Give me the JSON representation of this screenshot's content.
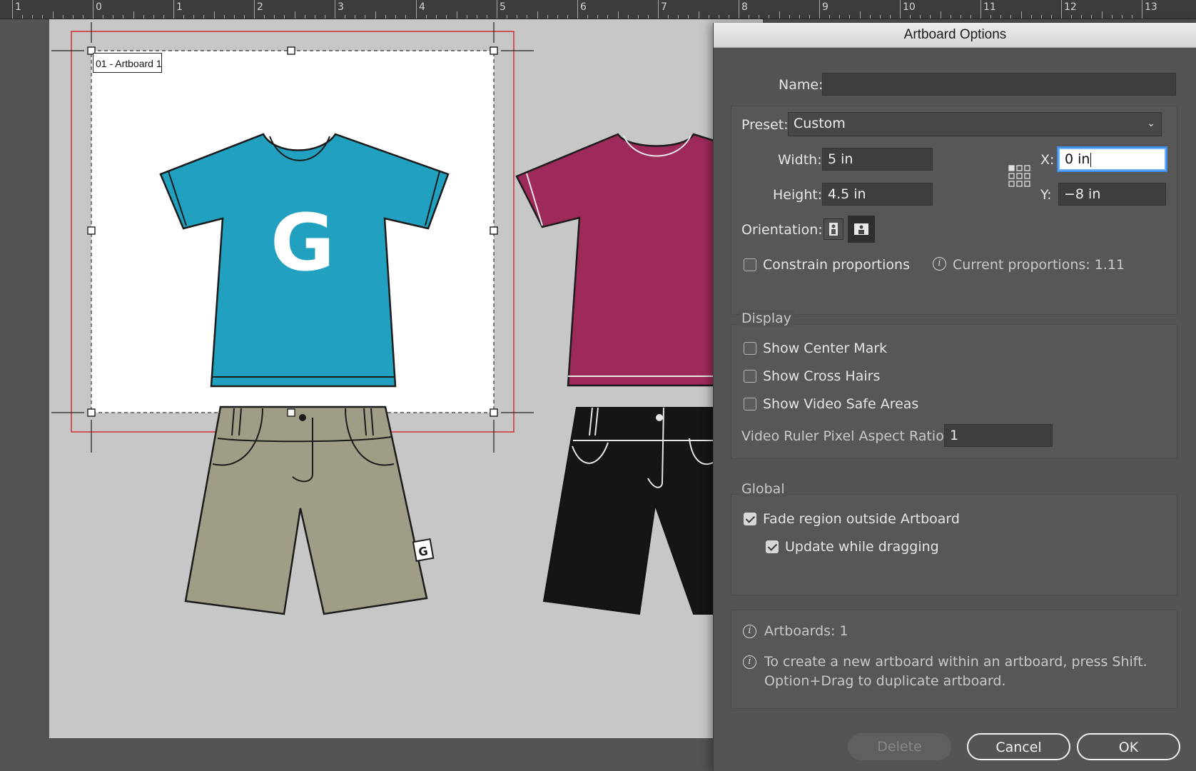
{
  "ruler": {
    "labels": [
      "1",
      "0",
      "1",
      "2",
      "3",
      "4",
      "5",
      "6",
      "7",
      "8",
      "9",
      "10",
      "11",
      "12",
      "13"
    ]
  },
  "artboard": {
    "label": "01 - Artboard 1",
    "shirt_letter": "G",
    "tag_letter": "G"
  },
  "colors": {
    "tshirt_blue": "#22a0bf",
    "tshirt_magenta": "#9e2a5a",
    "shorts_khaki": "#a09d87",
    "shorts_black": "#151515",
    "selection_red": "#d12f36"
  },
  "dialog": {
    "title": "Artboard Options",
    "name_label": "Name:",
    "name_value": "",
    "preset_label": "Preset:",
    "preset_value": "Custom",
    "width_label": "Width:",
    "width_value": "5 in",
    "height_label": "Height:",
    "height_value": "4.5 in",
    "x_label": "X:",
    "x_value": "0 in",
    "y_label": "Y:",
    "y_value": "−8 in",
    "orientation_label": "Orientation:",
    "constrain_label": "Constrain proportions",
    "proportions_text": "Current proportions: 1.11",
    "display_heading": "Display",
    "show_center_mark": "Show Center Mark",
    "show_cross_hairs": "Show Cross Hairs",
    "show_video_safe": "Show Video Safe Areas",
    "video_ruler_label": "Video Ruler Pixel Aspect Ratio:",
    "video_ruler_value": "1",
    "global_heading": "Global",
    "fade_region": "Fade region outside Artboard",
    "update_dragging": "Update while dragging",
    "artboards_count": "Artboards: 1",
    "tip_line1": "To create a new artboard within an artboard, press Shift.",
    "tip_line2": "Option+Drag to duplicate artboard.",
    "delete_label": "Delete",
    "cancel_label": "Cancel",
    "ok_label": "OK",
    "checkboxes": {
      "constrain": false,
      "center_mark": false,
      "cross_hairs": false,
      "video_safe": false,
      "fade_region": true,
      "update_dragging": true
    }
  }
}
